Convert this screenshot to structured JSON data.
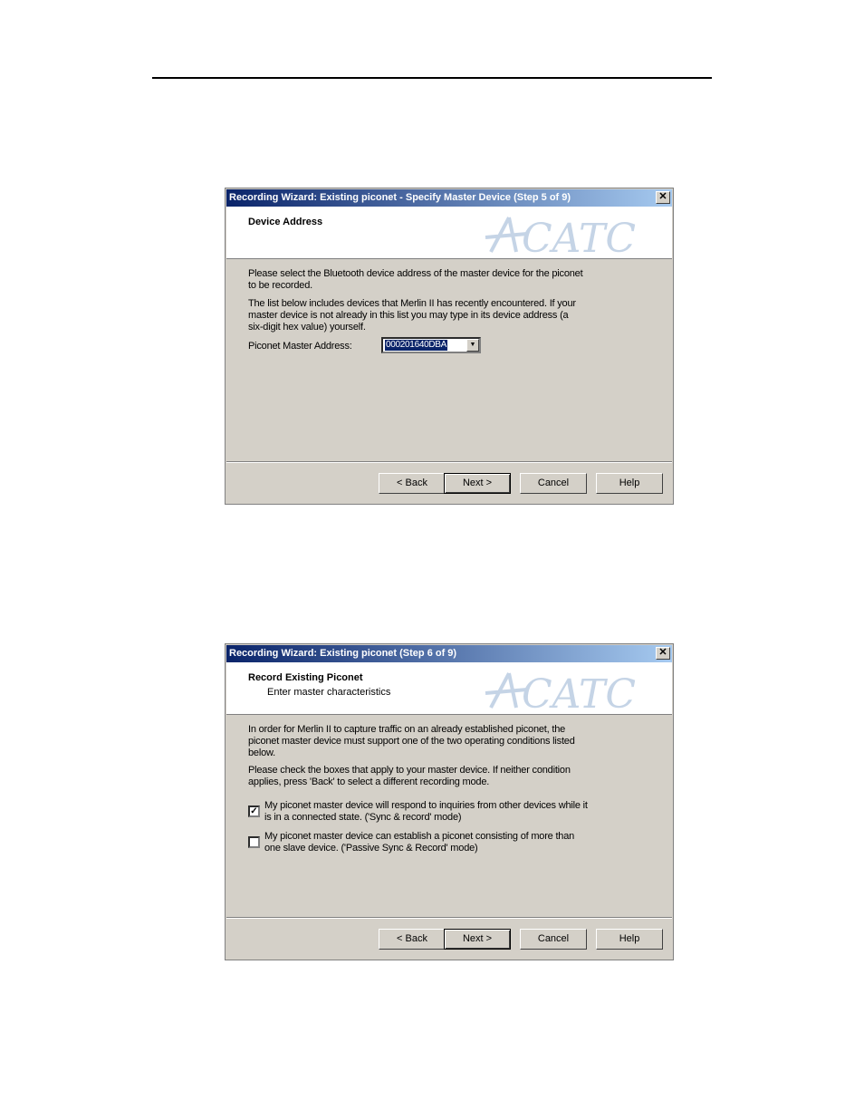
{
  "dialog1": {
    "title": "Recording Wizard: Existing piconet - Specify Master Device (Step 5 of 9)",
    "close_label": "✕",
    "header_title": "Device Address",
    "logo_text": "CATC",
    "para1": "Please select the Bluetooth device address of the master device for the piconet to be recorded.",
    "para2": "The list below includes devices that Merlin II  has recently encountered.  If your master device is not already in this list you may type in its device address (a six-digit hex value) yourself.",
    "address_label": "Piconet Master Address:",
    "address_value": "000201640DBA",
    "buttons": {
      "back": "< Back",
      "next": "Next >",
      "cancel": "Cancel",
      "help": "Help"
    }
  },
  "dialog2": {
    "title": "Recording Wizard: Existing piconet (Step 6 of 9)",
    "close_label": "✕",
    "header_title": "Record Existing Piconet",
    "header_subtitle": "Enter master characteristics",
    "logo_text": "CATC",
    "para1": "In order for Merlin II  to capture traffic on an already established piconet, the piconet master device must support one of the two operating conditions listed below.",
    "para2": "Please check the boxes that apply to your master device.  If neither condition applies, press 'Back' to select a different recording mode.",
    "options": [
      {
        "label": "My piconet master device will respond to inquiries from other devices while it is in a connected state. ('Sync & record' mode)",
        "checked": true
      },
      {
        "label": "My piconet master device can establish a piconet consisting of more than one slave device. ('Passive Sync & Record' mode)",
        "checked": false
      }
    ],
    "buttons": {
      "back": "< Back",
      "next": "Next >",
      "cancel": "Cancel",
      "help": "Help"
    }
  },
  "colors": {
    "titlebar_start": "#0a246a",
    "titlebar_end": "#a6caf0",
    "dialog_bg": "#d4d0c8",
    "logo": "#c5d4e6"
  }
}
